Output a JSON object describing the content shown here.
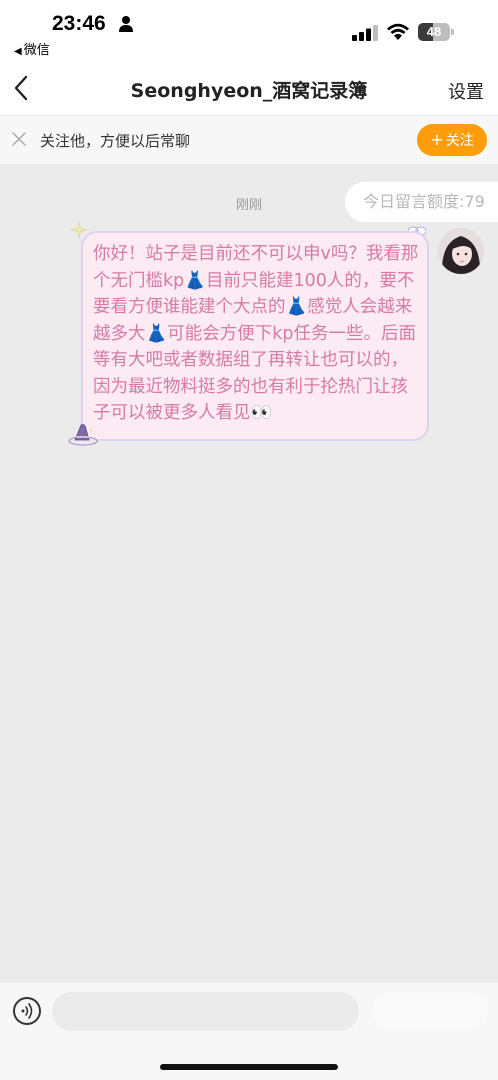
{
  "status_bar": {
    "time": "23:46",
    "back_app": "微信",
    "battery_level": "48",
    "battery_fraction": 0.48
  },
  "nav": {
    "title": "Seonghyeon_酒窝记录簿",
    "settings_label": "设置",
    "back_icon": "chevron-left-icon"
  },
  "follow_bar": {
    "prompt": "关注他，方便以后常聊",
    "button_label": "关注",
    "button_icon": "plus-icon",
    "accent_color": "#ff9d0d"
  },
  "chat": {
    "quota_text": "今日留言额度:79",
    "timestamp": "刚刚",
    "messages": [
      {
        "text": "你好！站子是目前还不可以申v吗？我看那个无门槛kp👗目前只能建100人的，要不要看方便谁能建个大点的👗感觉人会越来越多大👗可能会方便下kp任务一些。后面等有大吧或者数据组了再转让也可以的，因为最近物料挺多的也有利于抡热门让孩子可以被更多人看见👀",
        "bubble_color": "#fcebf3",
        "text_color": "#d77aa6"
      }
    ]
  },
  "input_bar": {
    "placeholder": "",
    "voice_icon": "voice-icon"
  }
}
